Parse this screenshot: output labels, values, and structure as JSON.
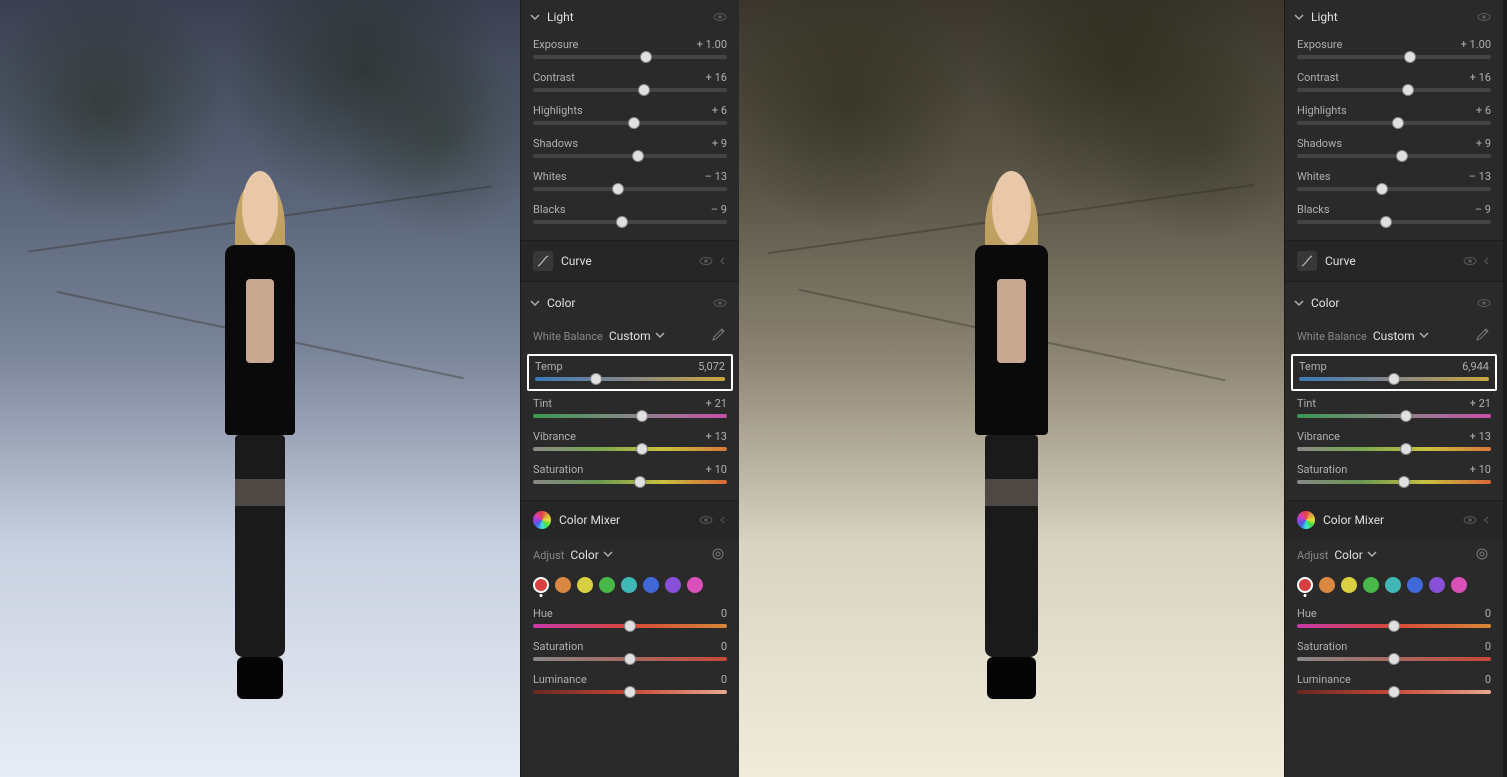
{
  "panels": [
    {
      "side": "left",
      "light": {
        "title": "Light",
        "exposure": {
          "label": "Exposure",
          "value": "+ 1.00",
          "pos": 58
        },
        "contrast": {
          "label": "Contrast",
          "value": "+ 16",
          "pos": 57
        },
        "highlights": {
          "label": "Highlights",
          "value": "+ 6",
          "pos": 52
        },
        "shadows": {
          "label": "Shadows",
          "value": "+ 9",
          "pos": 54
        },
        "whites": {
          "label": "Whites",
          "value": "– 13",
          "pos": 44
        },
        "blacks": {
          "label": "Blacks",
          "value": "– 9",
          "pos": 46
        }
      },
      "curve": {
        "title": "Curve"
      },
      "color": {
        "title": "Color",
        "wb_label": "White Balance",
        "wb_value": "Custom",
        "temp": {
          "label": "Temp",
          "value": "5,072",
          "pos": 32,
          "highlighted": true
        },
        "tint": {
          "label": "Tint",
          "value": "+ 21",
          "pos": 56
        },
        "vibrance": {
          "label": "Vibrance",
          "value": "+ 13",
          "pos": 56
        },
        "saturation": {
          "label": "Saturation",
          "value": "+ 10",
          "pos": 55
        }
      },
      "mixer": {
        "title": "Color Mixer",
        "adjust_label": "Adjust",
        "adjust_value": "Color",
        "selected_swatch": "red",
        "hue": {
          "label": "Hue",
          "value": "0",
          "pos": 50
        },
        "saturation": {
          "label": "Saturation",
          "value": "0",
          "pos": 50
        },
        "luminance": {
          "label": "Luminance",
          "value": "0",
          "pos": 50
        }
      }
    },
    {
      "side": "right",
      "light": {
        "title": "Light",
        "exposure": {
          "label": "Exposure",
          "value": "+ 1.00",
          "pos": 58
        },
        "contrast": {
          "label": "Contrast",
          "value": "+ 16",
          "pos": 57
        },
        "highlights": {
          "label": "Highlights",
          "value": "+ 6",
          "pos": 52
        },
        "shadows": {
          "label": "Shadows",
          "value": "+ 9",
          "pos": 54
        },
        "whites": {
          "label": "Whites",
          "value": "– 13",
          "pos": 44
        },
        "blacks": {
          "label": "Blacks",
          "value": "– 9",
          "pos": 46
        }
      },
      "curve": {
        "title": "Curve"
      },
      "color": {
        "title": "Color",
        "wb_label": "White Balance",
        "wb_value": "Custom",
        "temp": {
          "label": "Temp",
          "value": "6,944",
          "pos": 50,
          "highlighted": true
        },
        "tint": {
          "label": "Tint",
          "value": "+ 21",
          "pos": 56
        },
        "vibrance": {
          "label": "Vibrance",
          "value": "+ 13",
          "pos": 56
        },
        "saturation": {
          "label": "Saturation",
          "value": "+ 10",
          "pos": 55
        }
      },
      "mixer": {
        "title": "Color Mixer",
        "adjust_label": "Adjust",
        "adjust_value": "Color",
        "selected_swatch": "red",
        "hue": {
          "label": "Hue",
          "value": "0",
          "pos": 50
        },
        "saturation": {
          "label": "Saturation",
          "value": "0",
          "pos": 50
        },
        "luminance": {
          "label": "Luminance",
          "value": "0",
          "pos": 50
        }
      }
    }
  ],
  "swatch_colors": [
    "red",
    "orange",
    "yellow",
    "green",
    "aqua",
    "blue",
    "purple",
    "magenta"
  ]
}
